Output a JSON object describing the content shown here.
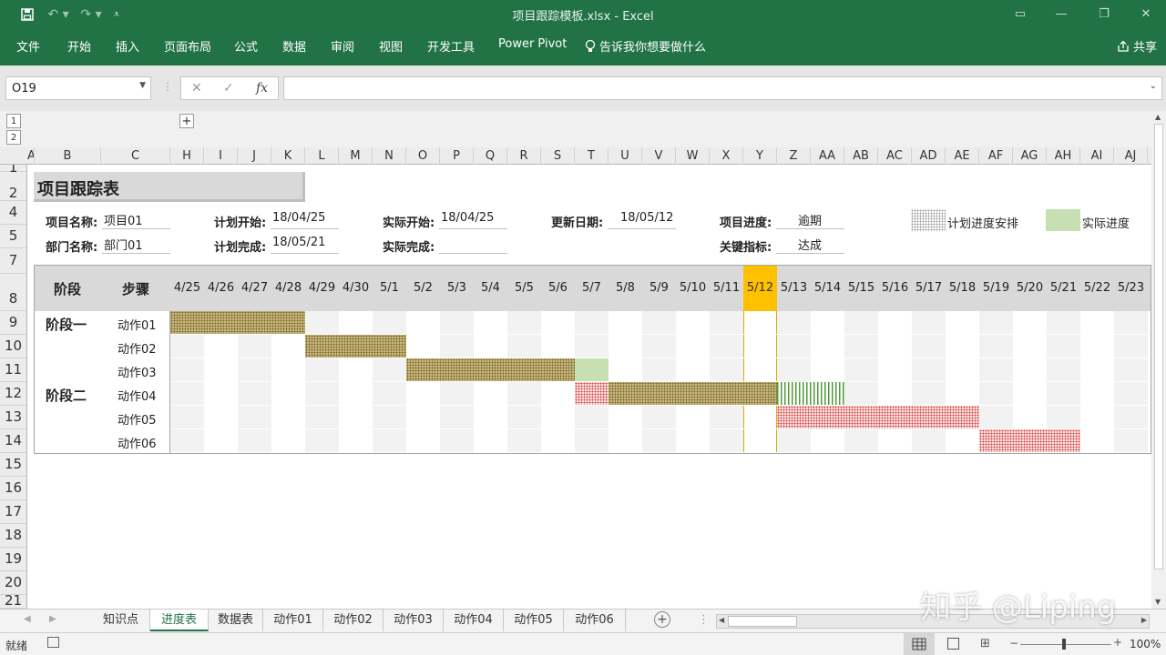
{
  "window": {
    "title": "项目跟踪模板.xlsx  -  Excel"
  },
  "ribbon": {
    "tabs": [
      "文件",
      "开始",
      "插入",
      "页面布局",
      "公式",
      "数据",
      "审阅",
      "视图",
      "开发工具",
      "Power Pivot"
    ],
    "tell_me": "告诉我你想要做什么",
    "share": "共享"
  },
  "formula_bar": {
    "name_box": "O19",
    "formula": ""
  },
  "outline": {
    "levels": [
      "1",
      "2"
    ],
    "expand": "+"
  },
  "columns": [
    "A",
    "B",
    "C",
    "H",
    "I",
    "J",
    "K",
    "L",
    "M",
    "N",
    "O",
    "P",
    "Q",
    "R",
    "S",
    "T",
    "U",
    "V",
    "W",
    "X",
    "Y",
    "Z",
    "AA",
    "AB",
    "AC",
    "AD",
    "AE",
    "AF",
    "AG",
    "AH",
    "AI",
    "AJ"
  ],
  "rows": [
    "1",
    "2",
    "4",
    "5",
    "7",
    "8",
    "9",
    "10",
    "11",
    "12",
    "13",
    "14",
    "15",
    "16",
    "17",
    "18",
    "19",
    "20",
    "21"
  ],
  "sheet": {
    "title": "项目跟踪表",
    "fields": {
      "project_name_label": "项目名称:",
      "project_name": "项目01",
      "dept_label": "部门名称:",
      "dept": "部门01",
      "plan_start_label": "计划开始:",
      "plan_start": "18/04/25",
      "plan_end_label": "计划完成:",
      "plan_end": "18/05/21",
      "actual_start_label": "实际开始:",
      "actual_start": "18/04/25",
      "actual_end_label": "实际完成:",
      "actual_end": "",
      "update_label": "更新日期:",
      "update": "18/05/12",
      "progress_label": "项目进度:",
      "progress": "逾期",
      "kpi_label": "关键指标:",
      "kpi": "达成"
    },
    "legend": {
      "plan": "计划进度安排",
      "actual": "实际进度"
    },
    "gantt": {
      "stage_header": "阶段",
      "step_header": "步骤",
      "dates": [
        "4/25",
        "4/26",
        "4/27",
        "4/28",
        "4/29",
        "4/30",
        "5/1",
        "5/2",
        "5/3",
        "5/4",
        "5/5",
        "5/6",
        "5/7",
        "5/8",
        "5/9",
        "5/10",
        "5/11",
        "5/12",
        "5/13",
        "5/14",
        "5/15",
        "5/16",
        "5/17",
        "5/18",
        "5/19",
        "5/20",
        "5/21",
        "5/22",
        "5/23"
      ],
      "today": "5/12",
      "stages": [
        {
          "name": "阶段一",
          "row": 0
        },
        {
          "name": "阶段二",
          "row": 3
        }
      ],
      "steps": [
        "动作01",
        "动作02",
        "动作03",
        "动作04",
        "动作05",
        "动作06"
      ],
      "bars": [
        {
          "row": 0,
          "start": "4/25",
          "end": "4/28",
          "kind": "plan"
        },
        {
          "row": 1,
          "start": "4/29",
          "end": "5/1",
          "kind": "plan"
        },
        {
          "row": 2,
          "start": "5/2",
          "end": "5/6",
          "kind": "plan"
        },
        {
          "row": 2,
          "start": "5/7",
          "end": "5/7",
          "kind": "actual"
        },
        {
          "row": 3,
          "start": "5/7",
          "end": "5/7",
          "kind": "late"
        },
        {
          "row": 3,
          "start": "5/8",
          "end": "5/12",
          "kind": "plan"
        },
        {
          "row": 3,
          "start": "5/13",
          "end": "5/14",
          "kind": "stripe"
        },
        {
          "row": 4,
          "start": "5/13",
          "end": "5/18",
          "kind": "late"
        },
        {
          "row": 5,
          "start": "5/19",
          "end": "5/21",
          "kind": "late"
        }
      ]
    }
  },
  "sheet_tabs": [
    "知识点",
    "进度表",
    "数据表",
    "动作01",
    "动作02",
    "动作03",
    "动作04",
    "动作05",
    "动作06"
  ],
  "active_tab": "进度表",
  "status": {
    "ready": "就绪",
    "zoom": "100%"
  },
  "watermark": "知乎 @Liping"
}
